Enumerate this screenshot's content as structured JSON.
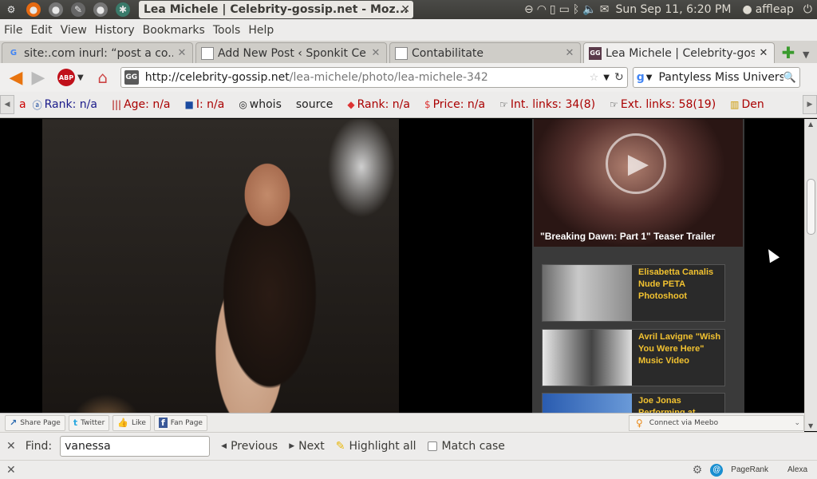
{
  "window": {
    "title": "Lea Michele | Celebrity-gossip.net - Moz..."
  },
  "system": {
    "datetime": "Sun Sep 11,  6:20 PM",
    "user": "affleap"
  },
  "menu": [
    "File",
    "Edit",
    "View",
    "History",
    "Bookmarks",
    "Tools",
    "Help"
  ],
  "tabs": [
    {
      "label": "site:.com inurl: “post a co...",
      "favicon": "G"
    },
    {
      "label": "Add New Post ‹ Sponkit Cel...",
      "favicon": "doc"
    },
    {
      "label": "Contabilitate",
      "favicon": "doc"
    },
    {
      "label": "Lea Michele | Celebrity-gos...",
      "favicon": "GG",
      "active": true
    }
  ],
  "nav": {
    "url_host": "http://celebrity-gossip.net",
    "url_path": "/lea-michele/photo/lea-michele-342",
    "search_value": "Pantyless Miss Univers",
    "abp_label": "ABP",
    "site_icon": "GG"
  },
  "seobar": {
    "items": [
      {
        "icon": "a",
        "label": "a"
      },
      {
        "icon": "@",
        "label": "Rank: n/a"
      },
      {
        "icon": "|||",
        "label": "Age: n/a"
      },
      {
        "icon": "■",
        "label": "I: n/a"
      },
      {
        "icon": "@",
        "label": "whois"
      },
      {
        "icon": "",
        "label": "source"
      },
      {
        "icon": "◆",
        "label": "Rank: n/a"
      },
      {
        "icon": "$",
        "label": "Price: n/a"
      },
      {
        "icon": "☞",
        "label": "Int. links: 34(8)"
      },
      {
        "icon": "☞",
        "label": "Ext. links: 58(19)"
      },
      {
        "icon": "▥",
        "label": "Den"
      }
    ]
  },
  "sidebar": {
    "video_caption": "\"Breaking Dawn: Part 1\" Teaser Trailer",
    "related": [
      {
        "title": "Elisabetta Canalis Nude PETA Photoshoot"
      },
      {
        "title": "Avril Lavigne \"Wish You Were Here\" Music Video"
      },
      {
        "title": "Joe Jonas Performing at"
      }
    ]
  },
  "sharebar": {
    "share": "Share Page",
    "twitter": "Twitter",
    "like": "Like",
    "fanpage": "Fan Page",
    "meebo": "Connect via Meebo"
  },
  "findbar": {
    "label": "Find:",
    "value": "vanessa",
    "previous": "Previous",
    "next": "Next",
    "highlight": "Highlight all",
    "match_case": "Match case"
  },
  "statusbar": {
    "pagerank": "PageRank",
    "alexa": "Alexa"
  }
}
